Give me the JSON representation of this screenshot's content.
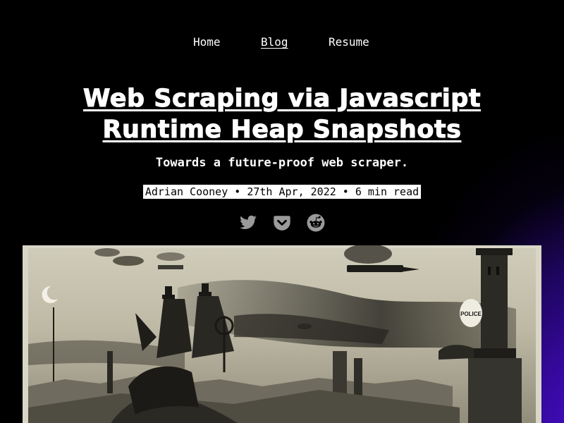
{
  "nav": {
    "items": [
      {
        "label": "Home",
        "active": false
      },
      {
        "label": "Blog",
        "active": true
      },
      {
        "label": "Resume",
        "active": false
      }
    ]
  },
  "post": {
    "title": "Web Scraping via Javascript Runtime Heap Snapshots",
    "subtitle": "Towards a future-proof web scraper.",
    "meta": "Adrian Cooney • 27th Apr, 2022 • 6 min read"
  },
  "share": {
    "icons": [
      "twitter-icon",
      "pocket-icon",
      "reddit-icon"
    ]
  },
  "hero": {
    "sign_text": "POLICE"
  },
  "colors": {
    "background": "#000000",
    "glow": "#4a0fd0",
    "text": "#ffffff",
    "icon": "#9a9a9a",
    "hero_paper": "#d9d6c6"
  }
}
